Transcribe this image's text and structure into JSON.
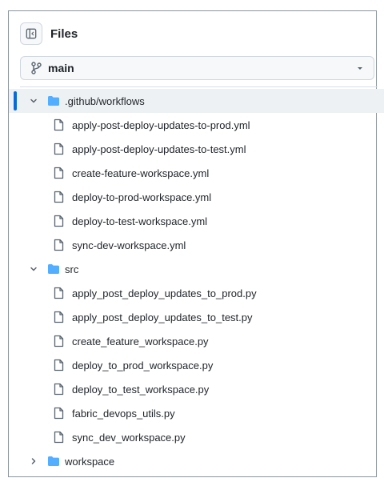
{
  "header": {
    "title": "Files",
    "toggle_icon": "sidebar-collapse-icon"
  },
  "branch": {
    "name": "main",
    "icon": "git-branch-icon",
    "caret_icon": "caret-down-icon"
  },
  "tree": {
    "folders": [
      {
        "name": ".github/workflows",
        "expanded": true,
        "files": [
          "apply-post-deploy-updates-to-prod.yml",
          "apply-post-deploy-updates-to-test.yml",
          "create-feature-workspace.yml",
          "deploy-to-prod-workspace.yml",
          "deploy-to-test-workspace.yml",
          "sync-dev-workspace.yml"
        ]
      },
      {
        "name": "src",
        "expanded": true,
        "files": [
          "apply_post_deploy_updates_to_prod.py",
          "apply_post_deploy_updates_to_test.py",
          "create_feature_workspace.py",
          "deploy_to_prod_workspace.py",
          "deploy_to_test_workspace.py",
          "fabric_devops_utils.py",
          "sync_dev_workspace.py"
        ]
      },
      {
        "name": "workspace",
        "expanded": false,
        "files": []
      }
    ]
  },
  "colors": {
    "folder": "#54aeff",
    "accent": "#0969da",
    "border": "#d0d7de"
  }
}
